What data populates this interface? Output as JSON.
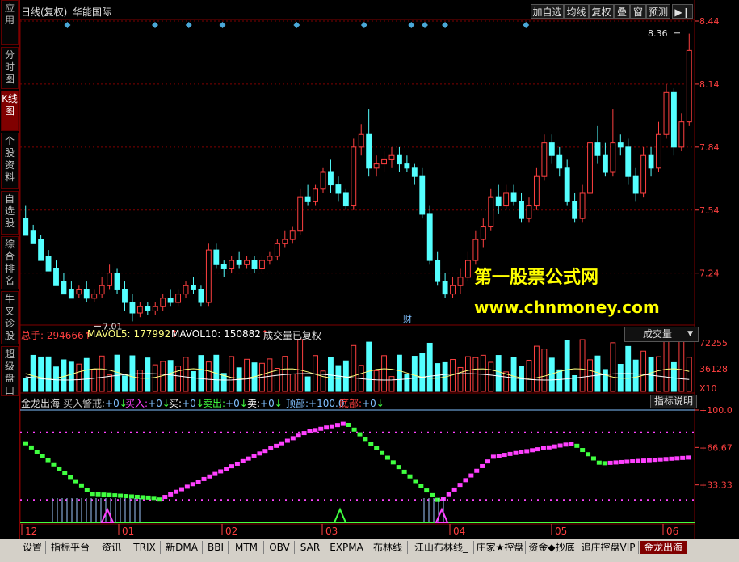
{
  "sidebar": {
    "tabs": [
      {
        "label": "应用",
        "active": false
      },
      {
        "label": "分时图",
        "active": false
      },
      {
        "label": "K线图",
        "active": true
      },
      {
        "label": "个股资料",
        "active": false
      },
      {
        "label": "自选股",
        "active": false
      },
      {
        "label": "综合排名",
        "active": false
      },
      {
        "label": "牛叉诊股",
        "active": false
      },
      {
        "label": "超级盘口",
        "active": false
      }
    ]
  },
  "header": {
    "period": "日线(复权)",
    "stock_name": "华能国际",
    "buttons": [
      "加自选",
      "均线",
      "复权",
      "叠",
      "窗",
      "预测"
    ],
    "more_icon": "play-pause-icon"
  },
  "price_panel": {
    "y_labels": [
      "8.44",
      "8.14",
      "7.84",
      "7.54",
      "7.24"
    ],
    "high_marker": "8.36",
    "low_marker": "7.01",
    "finance_tag": "财"
  },
  "watermark": {
    "line1": "第一股票公式网",
    "line2": "www.chnmoney.com"
  },
  "volume_panel": {
    "title_total": "总手:",
    "total_value": "294666",
    "ma5_label": "MAVOL5:",
    "ma5_value": "177992",
    "ma10_label": "MAVOL10:",
    "ma10_value": "150882",
    "note": "成交量已复权",
    "selector": "成交量",
    "y_labels": [
      "72255",
      "36128"
    ],
    "unit": "X10"
  },
  "indicator_panel": {
    "name": "金龙出海",
    "items": [
      {
        "label": "买入警戒:",
        "value": "+0",
        "color": "#c0c0c0"
      },
      {
        "label": "买入:",
        "value": "+0",
        "color": "#ff40ff"
      },
      {
        "label": "买:",
        "value": "+0",
        "color": "#ffffff"
      },
      {
        "label": "卖出:",
        "value": "+0",
        "color": "#40ff40"
      },
      {
        "label": "卖:",
        "value": "+0",
        "color": "#ffffff"
      },
      {
        "label": "顶部:",
        "value": "+100.0",
        "color": "#80c0ff"
      },
      {
        "label": "底部:",
        "value": "+0",
        "color": "#ff4040"
      }
    ],
    "explain_button": "指标说明",
    "y_labels": [
      "+100.0",
      "+66.67",
      "+33.33"
    ]
  },
  "x_axis": {
    "labels": [
      "12",
      "01",
      "02",
      "03",
      "04",
      "05",
      "06"
    ]
  },
  "bottom_tabs": [
    {
      "label": "设置",
      "active": false
    },
    {
      "label": "指标平台",
      "active": false
    },
    {
      "label": "资讯",
      "active": false
    },
    {
      "label": "TRIX",
      "active": false
    },
    {
      "label": "新DMA",
      "active": false
    },
    {
      "label": "BBI",
      "active": false
    },
    {
      "label": "MTM",
      "active": false
    },
    {
      "label": "OBV",
      "active": false
    },
    {
      "label": "SAR",
      "active": false
    },
    {
      "label": "EXPMA",
      "active": false
    },
    {
      "label": "布林线",
      "active": false
    },
    {
      "label": "江山布林线_",
      "active": false
    },
    {
      "label": "庄家★控盘",
      "active": false
    },
    {
      "label": "资金◆抄底",
      "active": false
    },
    {
      "label": "追庄控盘VIP",
      "active": false
    },
    {
      "label": "金龙出海",
      "active": true
    }
  ],
  "colors": {
    "up": "#ff4040",
    "down": "#54ffff",
    "grid": "#800000",
    "axis_text": "#ff4040",
    "buy_signal": "#ff40ff",
    "sell_signal": "#40ff40"
  },
  "chart_data": {
    "type": "candlestick",
    "price_ylim": [
      7.0,
      8.44
    ],
    "candles_ohlc_approx": [
      [
        7.5,
        7.42,
        7.56,
        7.44
      ],
      [
        7.44,
        7.38,
        7.47,
        7.4
      ],
      [
        7.4,
        7.3,
        7.42,
        7.32
      ],
      [
        7.32,
        7.25,
        7.35,
        7.26
      ],
      [
        7.26,
        7.18,
        7.3,
        7.2
      ],
      [
        7.2,
        7.14,
        7.24,
        7.16
      ],
      [
        7.16,
        7.12,
        7.2,
        7.14
      ],
      [
        7.14,
        7.16,
        7.18,
        7.12
      ],
      [
        7.16,
        7.12,
        7.2,
        7.1
      ],
      [
        7.12,
        7.14,
        7.16,
        7.1
      ],
      [
        7.14,
        7.18,
        7.22,
        7.12
      ],
      [
        7.18,
        7.24,
        7.28,
        7.16
      ],
      [
        7.24,
        7.16,
        7.26,
        7.14
      ],
      [
        7.16,
        7.1,
        7.2,
        7.06
      ],
      [
        7.1,
        7.05,
        7.14,
        7.01
      ],
      [
        7.05,
        7.08,
        7.1,
        7.03
      ],
      [
        7.08,
        7.06,
        7.1,
        7.04
      ],
      [
        7.06,
        7.08,
        7.1,
        7.04
      ],
      [
        7.08,
        7.12,
        7.14,
        7.06
      ],
      [
        7.12,
        7.1,
        7.16,
        7.08
      ],
      [
        7.1,
        7.14,
        7.16,
        7.08
      ],
      [
        7.14,
        7.18,
        7.2,
        7.12
      ],
      [
        7.18,
        7.16,
        7.22,
        7.14
      ],
      [
        7.16,
        7.1,
        7.18,
        7.08
      ],
      [
        7.1,
        7.35,
        7.38,
        7.08
      ],
      [
        7.35,
        7.28,
        7.38,
        7.26
      ],
      [
        7.28,
        7.26,
        7.3,
        7.22
      ],
      [
        7.26,
        7.3,
        7.32,
        7.24
      ],
      [
        7.3,
        7.28,
        7.34,
        7.26
      ],
      [
        7.28,
        7.3,
        7.32,
        7.26
      ],
      [
        7.3,
        7.26,
        7.32,
        7.24
      ],
      [
        7.26,
        7.3,
        7.32,
        7.24
      ],
      [
        7.3,
        7.32,
        7.34,
        7.28
      ],
      [
        7.32,
        7.38,
        7.4,
        7.3
      ],
      [
        7.38,
        7.4,
        7.44,
        7.36
      ],
      [
        7.4,
        7.44,
        7.46,
        7.38
      ],
      [
        7.44,
        7.6,
        7.64,
        7.42
      ],
      [
        7.6,
        7.58,
        7.66,
        7.56
      ],
      [
        7.58,
        7.64,
        7.66,
        7.56
      ],
      [
        7.64,
        7.72,
        7.74,
        7.62
      ],
      [
        7.72,
        7.66,
        7.78,
        7.62
      ],
      [
        7.66,
        7.62,
        7.7,
        7.58
      ],
      [
        7.62,
        7.56,
        7.64,
        7.54
      ],
      [
        7.56,
        7.84,
        7.88,
        7.54
      ],
      [
        7.84,
        7.9,
        7.95,
        7.8
      ],
      [
        7.9,
        7.74,
        8.02,
        7.7
      ],
      [
        7.74,
        7.76,
        7.8,
        7.7
      ],
      [
        7.76,
        7.78,
        7.82,
        7.72
      ],
      [
        7.78,
        7.8,
        7.84,
        7.74
      ],
      [
        7.8,
        7.76,
        7.84,
        7.72
      ],
      [
        7.76,
        7.74,
        7.8,
        7.72
      ],
      [
        7.74,
        7.7,
        7.76,
        7.66
      ],
      [
        7.7,
        7.52,
        7.74,
        7.5
      ],
      [
        7.52,
        7.3,
        7.56,
        7.28
      ],
      [
        7.3,
        7.2,
        7.34,
        7.18
      ],
      [
        7.2,
        7.14,
        7.24,
        7.12
      ],
      [
        7.14,
        7.18,
        7.22,
        7.12
      ],
      [
        7.18,
        7.22,
        7.26,
        7.14
      ],
      [
        7.22,
        7.3,
        7.34,
        7.2
      ],
      [
        7.3,
        7.4,
        7.44,
        7.28
      ],
      [
        7.4,
        7.46,
        7.5,
        7.36
      ],
      [
        7.46,
        7.6,
        7.64,
        7.44
      ],
      [
        7.6,
        7.56,
        7.66,
        7.52
      ],
      [
        7.56,
        7.62,
        7.66,
        7.54
      ],
      [
        7.62,
        7.58,
        7.66,
        7.56
      ],
      [
        7.58,
        7.5,
        7.62,
        7.48
      ],
      [
        7.5,
        7.56,
        7.6,
        7.48
      ],
      [
        7.56,
        7.7,
        7.74,
        7.54
      ],
      [
        7.7,
        7.86,
        7.9,
        7.68
      ],
      [
        7.86,
        7.8,
        7.9,
        7.76
      ],
      [
        7.8,
        7.74,
        7.84,
        7.7
      ],
      [
        7.74,
        7.58,
        7.78,
        7.56
      ],
      [
        7.58,
        7.5,
        7.62,
        7.48
      ],
      [
        7.5,
        7.62,
        7.66,
        7.48
      ],
      [
        7.62,
        7.86,
        7.9,
        7.6
      ],
      [
        7.86,
        7.8,
        7.94,
        7.76
      ],
      [
        7.8,
        7.72,
        7.86,
        7.7
      ],
      [
        7.72,
        7.86,
        8.02,
        7.7
      ],
      [
        7.86,
        7.84,
        7.9,
        7.8
      ],
      [
        7.84,
        7.7,
        7.88,
        7.66
      ],
      [
        7.7,
        7.62,
        7.74,
        7.58
      ],
      [
        7.62,
        7.8,
        7.84,
        7.6
      ],
      [
        7.8,
        7.74,
        7.84,
        7.7
      ],
      [
        7.74,
        7.9,
        7.96,
        7.72
      ],
      [
        7.9,
        8.1,
        8.14,
        7.88
      ],
      [
        8.1,
        7.84,
        8.12,
        7.8
      ],
      [
        7.84,
        7.96,
        8.0,
        7.82
      ],
      [
        7.96,
        8.3,
        8.38,
        7.94
      ]
    ]
  }
}
